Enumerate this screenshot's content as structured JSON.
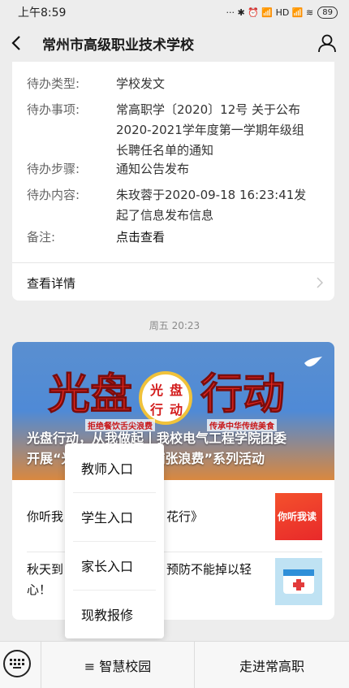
{
  "status_bar": {
    "time": "上午8:59",
    "icons": "··· ✱ ⏰ 📶 HD 📶 ≋",
    "battery": "89"
  },
  "header": {
    "title": "常州市高级职业技术学校",
    "back_icon": "chevron-left-icon",
    "profile_icon": "person-icon"
  },
  "message": {
    "rows": [
      {
        "label": "待办类型:",
        "value": "学校发文"
      },
      {
        "label": "待办事项:",
        "value_lines": [
          "常高职学〔2020〕12号  关于公布",
          "2020-2021学年度第一学期年级组",
          "长聘任名单的通知"
        ]
      },
      {
        "label": "待办步骤:",
        "value": "通知公告发布"
      },
      {
        "label": "待办内容:",
        "value_lines": [
          "朱玫蓉于2020-09-18 16:23:41发",
          "起了信息发布信息"
        ]
      },
      {
        "label": "备注:",
        "value": "点击查看"
      }
    ],
    "detail_label": "查看详情"
  },
  "timestamp": "周五 20:23",
  "article": {
    "banner": {
      "big_left": "光盘",
      "big_right": "行动",
      "plate_chars": [
        "光",
        "盘",
        "行",
        "动"
      ],
      "slogan_left": "拒绝餐饮舌尖浪费",
      "slogan_right": "传承中华传统美食",
      "caption_line1": "光盘行动，从我做起丨我校电气工程学院团委",
      "caption_line2": "开展“光盘行动，反对铺张浪费”系列活动"
    },
    "items": [
      {
        "text_left": "你听我",
        "text_right": "花行》",
        "thumb_text": "你听我读"
      },
      {
        "text_left": "秋天到",
        "text_right": "预防不能掉以轻",
        "text_line2": "心！"
      }
    ]
  },
  "popup": {
    "items": [
      "教师入口",
      "学生入口",
      "家长入口",
      "现教报修"
    ]
  },
  "bottom_bar": {
    "menu1": "≡ 智慧校园",
    "menu2": "走进常高职"
  }
}
